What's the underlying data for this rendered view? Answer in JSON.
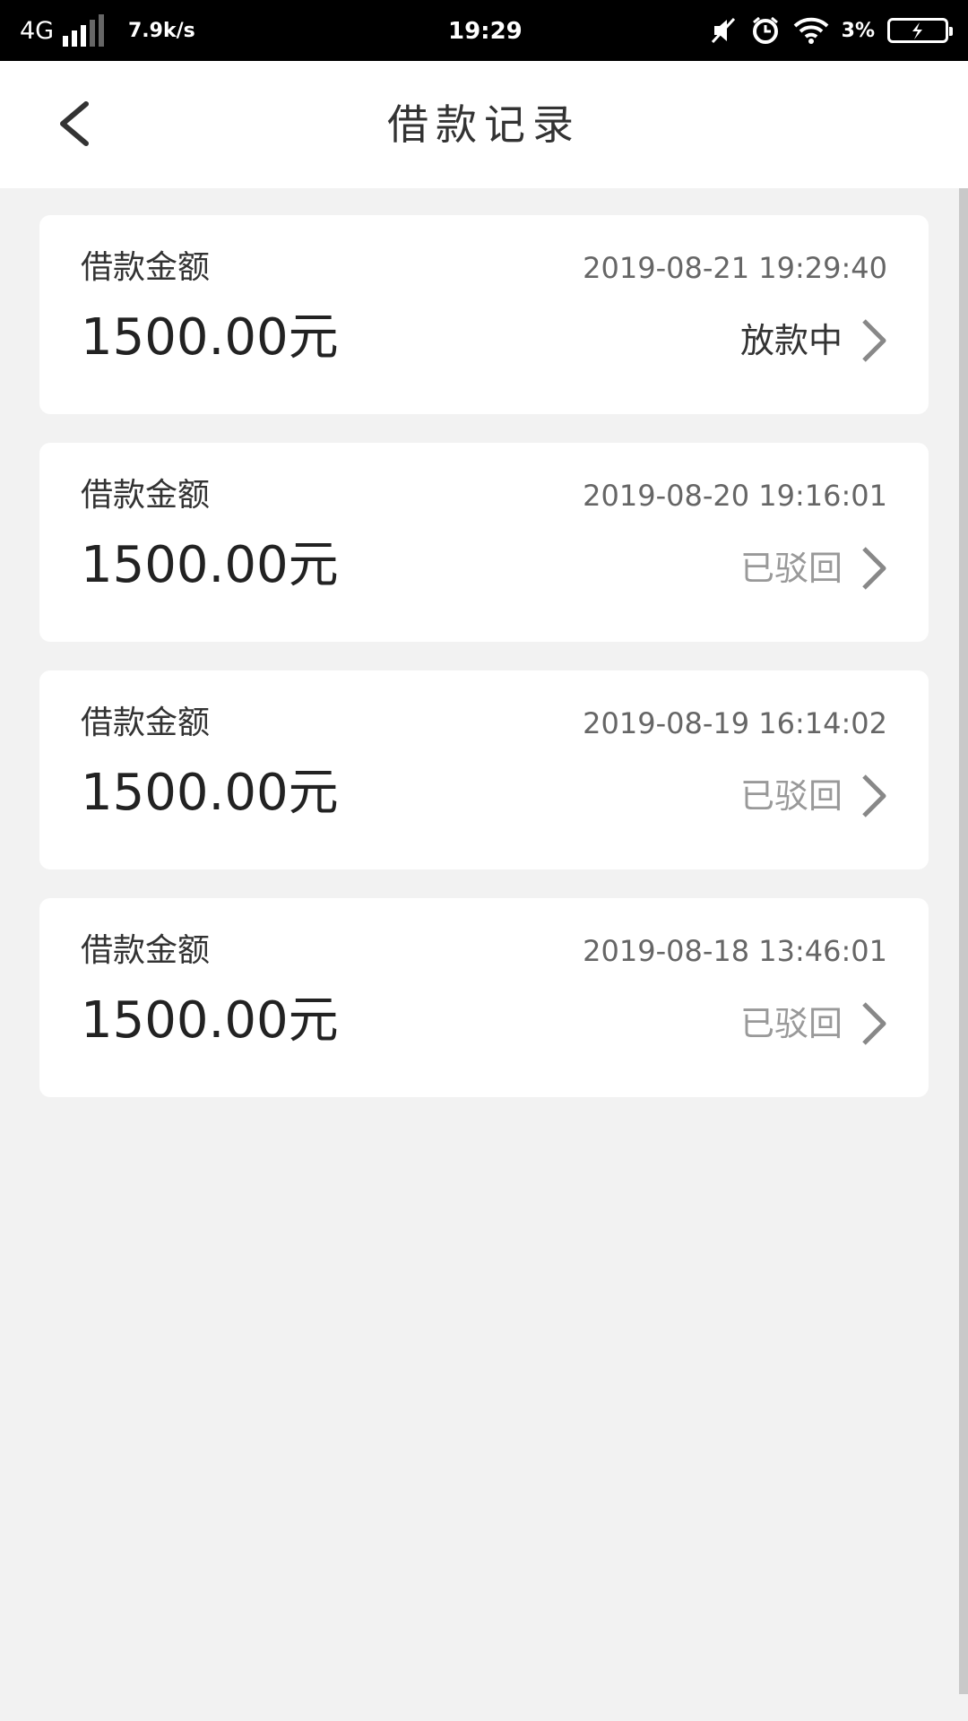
{
  "status_bar": {
    "network": "4G",
    "speed": "7.9k/s",
    "time": "19:29",
    "battery_pct": "3%"
  },
  "header": {
    "title": "借款记录"
  },
  "records": [
    {
      "label": "借款金额",
      "date": "2019-08-21 19:29:40",
      "amount": "1500.00元",
      "status": "放款中",
      "status_type": "active"
    },
    {
      "label": "借款金额",
      "date": "2019-08-20 19:16:01",
      "amount": "1500.00元",
      "status": "已驳回",
      "status_type": "rejected"
    },
    {
      "label": "借款金额",
      "date": "2019-08-19 16:14:02",
      "amount": "1500.00元",
      "status": "已驳回",
      "status_type": "rejected"
    },
    {
      "label": "借款金额",
      "date": "2019-08-18 13:46:01",
      "amount": "1500.00元",
      "status": "已驳回",
      "status_type": "rejected"
    }
  ],
  "colors": {
    "status_active": "#333333",
    "status_rejected": "#999999",
    "background": "#f2f2f2",
    "card": "#ffffff"
  },
  "icons": {
    "back": "chevron-left-icon",
    "row": "chevron-right-icon",
    "mute": "mute-icon",
    "alarm": "alarm-icon",
    "wifi": "wifi-icon",
    "battery": "battery-charging-icon"
  }
}
